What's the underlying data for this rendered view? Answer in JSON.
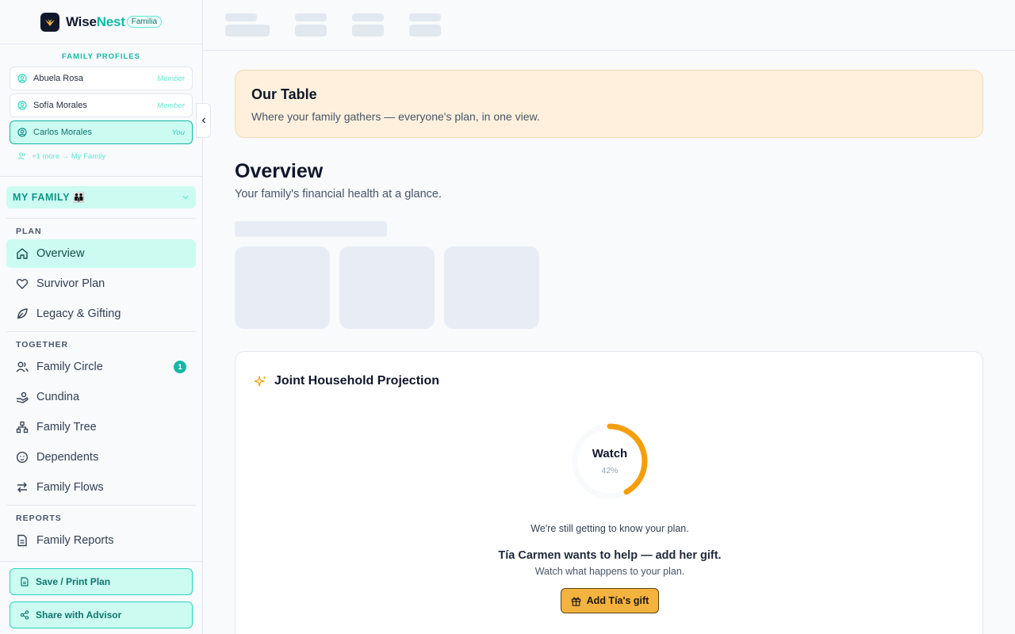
{
  "brand": {
    "name_part1": "Wise",
    "name_part2": "Nest",
    "badge": "Familia"
  },
  "profiles": {
    "caption": "FAMILY PROFILES",
    "items": [
      {
        "name": "Abuela Rosa",
        "role": "Member"
      },
      {
        "name": "Sofía Morales",
        "role": "Member"
      },
      {
        "name": "Carlos Morales",
        "role": "You"
      }
    ],
    "more": "+1 more → My Family"
  },
  "family_select": {
    "label": "MY FAMILY 👪"
  },
  "nav": {
    "plan": {
      "caption": "PLAN",
      "items": [
        "Overview",
        "Survivor Plan",
        "Legacy & Gifting"
      ]
    },
    "together": {
      "caption": "TOGETHER",
      "items": [
        "Family Circle",
        "Cundina",
        "Family Tree",
        "Dependents",
        "Family Flows"
      ],
      "family_circle_badge": "1"
    },
    "reports": {
      "caption": "REPORTS",
      "items": [
        "Family Reports"
      ]
    }
  },
  "footer": {
    "save_label": "Save / Print Plan",
    "share_label": "Share with Advisor"
  },
  "banner": {
    "title": "Our Table",
    "subtitle": "Where your family gathers — everyone's plan, in one view."
  },
  "page": {
    "title": "Overview",
    "subtitle": "Your family's financial health at a glance."
  },
  "projection": {
    "title": "Joint Household Projection",
    "gauge_label": "Watch",
    "gauge_percent": "42%",
    "gauge_value": 0.42,
    "note": "We're still getting to know your plan.",
    "help_title": "Tía Carmen wants to help — add her gift.",
    "help_sub": "Watch what happens to your plan.",
    "button_label": "Add Tía's gift"
  },
  "colors": {
    "accent": "#14b8a6",
    "gauge": "#f59e0b",
    "button": "#f4b23e"
  }
}
